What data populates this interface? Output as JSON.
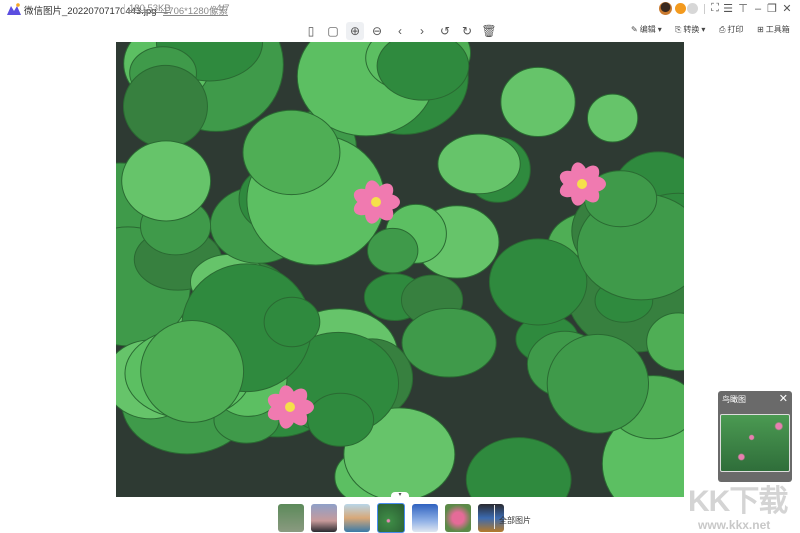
{
  "app": {
    "filename": "微信图片_20220707170443.jpg",
    "filesize": "180.53KB",
    "dimensions": "1706*1280像素",
    "position": "4/7"
  },
  "window": {
    "icons": [
      "avatar",
      "vip-icon",
      "coin-icon",
      "fullscreen-icon",
      "menu-icon",
      "pin-icon",
      "minimize-icon",
      "restore-icon",
      "close-icon"
    ]
  },
  "toolbar": {
    "edit": "编辑",
    "convert": "转换",
    "print": "打印",
    "toolbox": "工具箱"
  },
  "thumbnails": {
    "all_label": "全部图片",
    "count": 7,
    "selected_index": 3
  },
  "navigator": {
    "title": "鸟瞰图"
  },
  "watermark": {
    "logo": "KK下载",
    "url": "www.kkx.net"
  },
  "colors": {
    "accent": "#4a8cf0"
  }
}
